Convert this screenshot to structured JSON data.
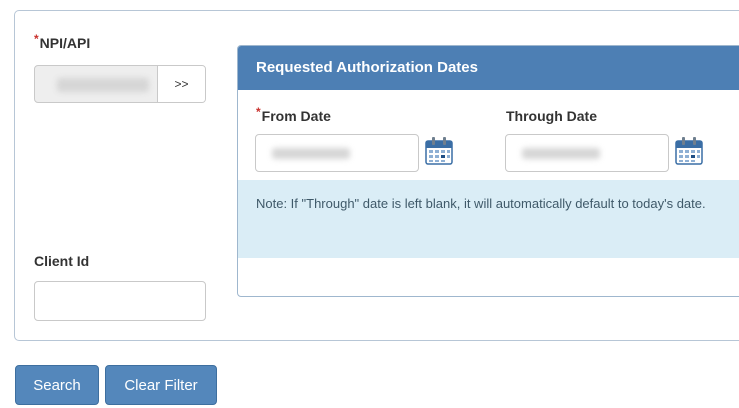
{
  "form": {
    "npi": {
      "required_mark": "*",
      "label": "NPI/API",
      "lookup_label": ">>"
    },
    "client_id": {
      "label": "Client Id",
      "value": ""
    },
    "dates": {
      "title": "Requested Authorization Dates",
      "from": {
        "required_mark": "*",
        "label": "From Date",
        "icon": "calendar-icon"
      },
      "through": {
        "label": "Through Date",
        "icon": "calendar-icon"
      },
      "note": "Note: If \"Through\" date is left blank, it will automatically default to today's date."
    }
  },
  "actions": {
    "search_label": "Search",
    "clear_label": "Clear Filter"
  },
  "colors": {
    "accent": "#4d7fb4",
    "button": "#5487bb",
    "required": "#c9302c",
    "note_bg": "#daedf6"
  }
}
